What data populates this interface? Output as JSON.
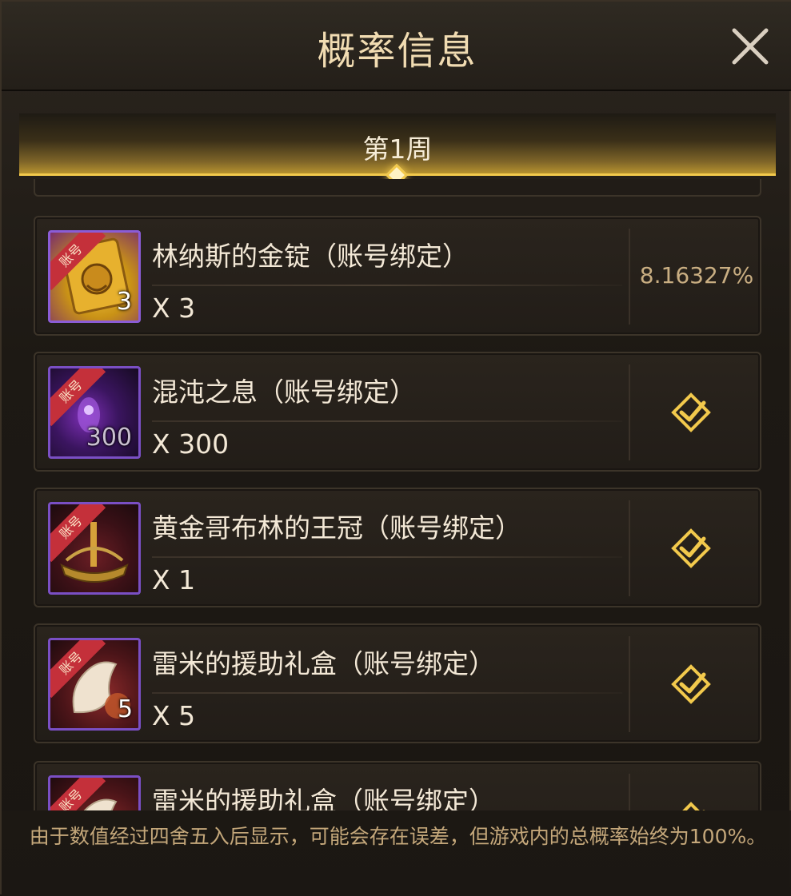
{
  "dialog": {
    "title": "概率信息",
    "close_icon": "close-icon"
  },
  "tabs": [
    {
      "label": "第1周",
      "selected": true
    }
  ],
  "items": [
    {
      "name": "林纳斯的金锭（账号绑定）",
      "count": "X 3",
      "badge": "3",
      "probability": "8.16327%",
      "ribbon": "账号",
      "icon": "gold-ingot-icon"
    },
    {
      "name": "混沌之息（账号绑定）",
      "count": "X 300",
      "badge": "300",
      "probability": "",
      "ribbon": "账号",
      "icon": "chaos-breath-icon"
    },
    {
      "name": "黄金哥布林的王冠（账号绑定）",
      "count": "X 1",
      "badge": "",
      "probability": "",
      "ribbon": "账号",
      "icon": "goblin-crown-icon"
    },
    {
      "name": "雷米的援助礼盒（账号绑定）",
      "count": "X 5",
      "badge": "5",
      "probability": "",
      "ribbon": "账号",
      "icon": "gift-box-icon"
    },
    {
      "name": "雷米的援助礼盒（账号绑定）",
      "count": "",
      "badge": "",
      "probability": "",
      "ribbon": "账号",
      "icon": "gift-box-icon"
    }
  ],
  "footer": {
    "note": "由于数值经过四舍五入后显示，可能会存在误差，但游戏内的总概率始终为100%。"
  },
  "colors": {
    "accent_gold": "#f2c94c",
    "title_text": "#f1dcb2",
    "probability_text": "#c9ae82",
    "ribbon_red": "#c4303a",
    "icon_border_purple": "#8b5cd6"
  }
}
